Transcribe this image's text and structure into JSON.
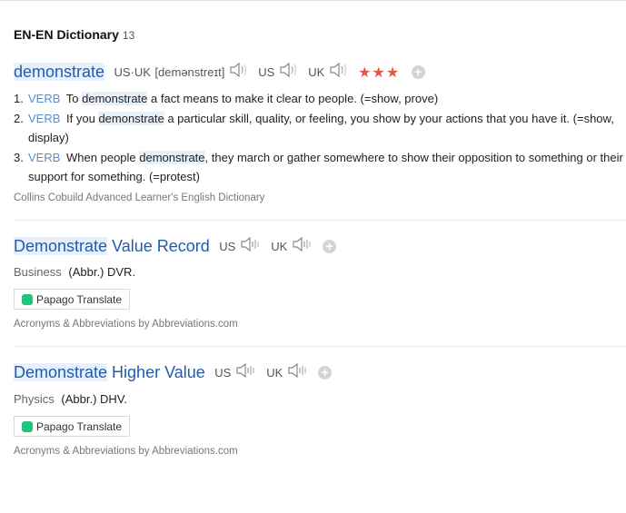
{
  "section": {
    "title": "EN-EN Dictionary",
    "count": "13"
  },
  "entry1": {
    "headword": "demonstrate",
    "pron_label": "US·UK",
    "pron_text": "[demənstreɪt]",
    "us_label": "US",
    "uk_label": "UK",
    "stars": "★★★",
    "definitions": [
      {
        "num": "1.",
        "pos": "VERB",
        "pre": "To ",
        "hl": "demonstrate",
        "post": " a fact means to make it clear to people. (=show, prove)"
      },
      {
        "num": "2.",
        "pos": "VERB",
        "pre": "If you ",
        "hl": "demonstrate",
        "post": " a particular skill, quality, or feeling, you show by your actions that you have it. (=show, display)"
      },
      {
        "num": "3.",
        "pos": "VERB",
        "pre": "When people ",
        "hl": "demonstrate",
        "post": ", they march or gather somewhere to show their opposition to something or their support for something. (=protest)"
      }
    ],
    "source": "Collins Cobuild Advanced Learner's English Dictionary"
  },
  "entry2": {
    "hl": "Demonstrate",
    "rest": " Value Record",
    "us_label": "US",
    "uk_label": "UK",
    "field": "Business",
    "abbr": "(Abbr.) DVR.",
    "translate_label": "Papago Translate",
    "source": "Acronyms & Abbreviations by Abbreviations.com"
  },
  "entry3": {
    "hl": "Demonstrate",
    "rest": " Higher Value",
    "us_label": "US",
    "uk_label": "UK",
    "field": "Physics",
    "abbr": "(Abbr.) DHV.",
    "translate_label": "Papago Translate",
    "source": "Acronyms & Abbreviations by Abbreviations.com"
  },
  "icons": [
    "speaker-icon",
    "add-icon",
    "papago-icon"
  ],
  "colors": {
    "headword": "#1d5cb4",
    "pos": "#5a8ec7",
    "stars": "#e05a47",
    "highlight": "#e8f1fb",
    "papago": "#1ec67a"
  }
}
